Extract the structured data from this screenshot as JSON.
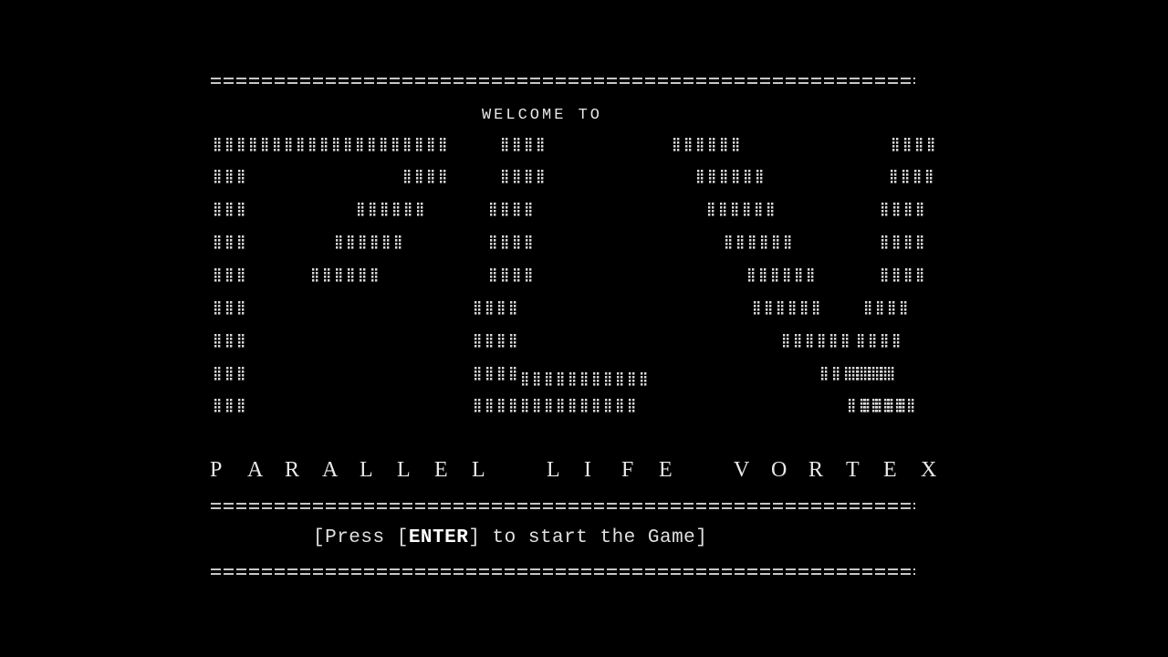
{
  "screen": {
    "welcome_text": "WELCOME TO",
    "logo_text": "PLV",
    "subtitle_text": "PARALLEL LIFE VORTEX",
    "prompt": {
      "before": "[Press [",
      "key": "ENTER",
      "after": "] to start the Game]"
    },
    "colors": {
      "background": "#000000",
      "text": "#e6e6e6"
    }
  }
}
